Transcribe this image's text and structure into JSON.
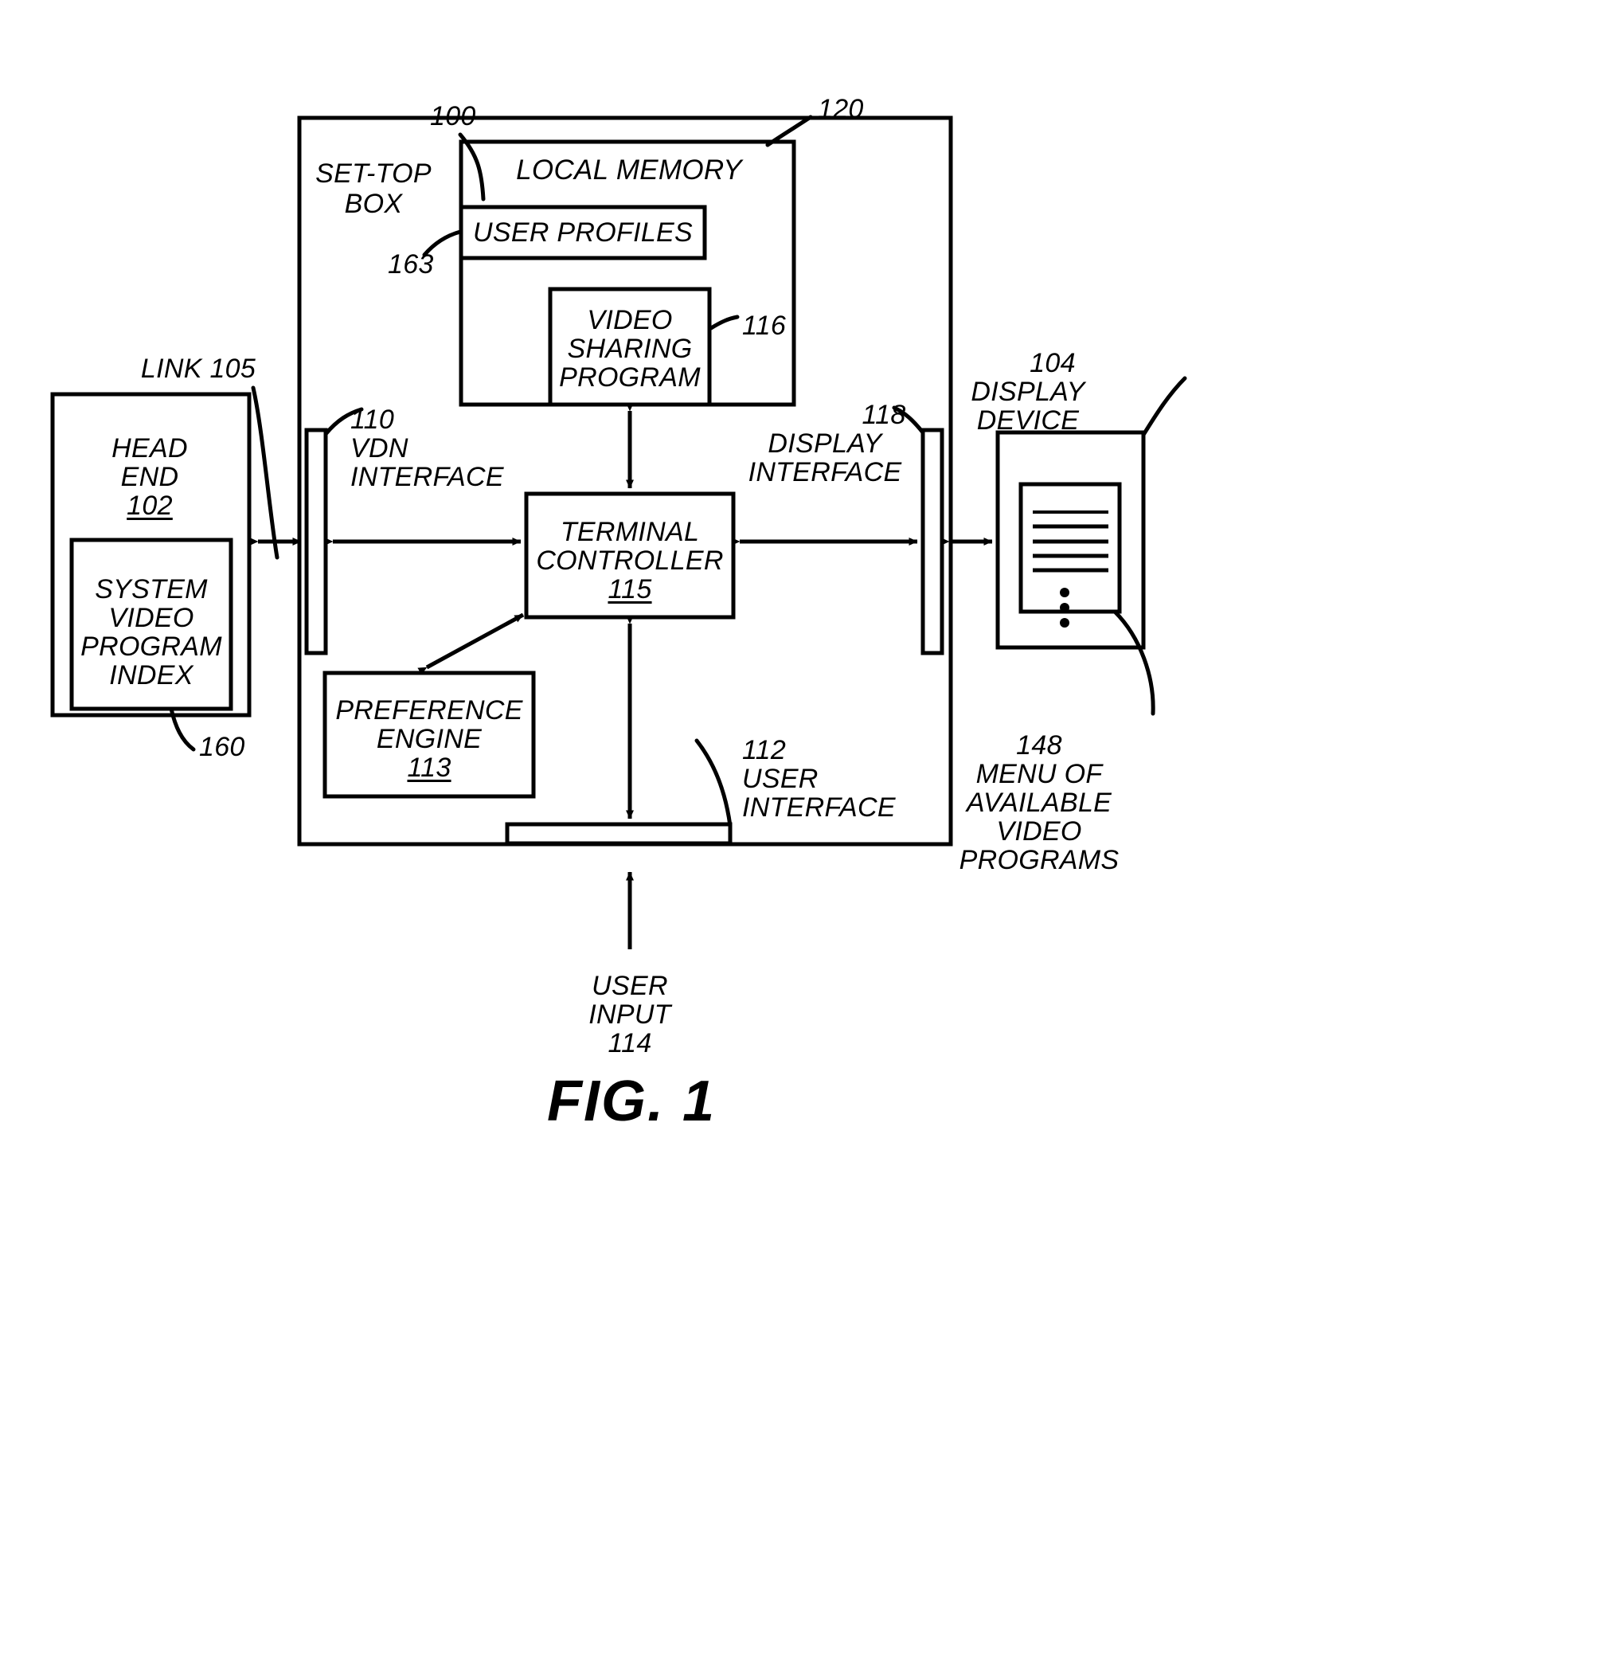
{
  "figure": {
    "caption": "FIG. 1",
    "title": "Set-top box video sharing system block diagram"
  },
  "blocks": {
    "set_top_box": {
      "label": "SET-TOP\nBOX",
      "ref": "100"
    },
    "local_memory": {
      "label": "LOCAL MEMORY",
      "ref": "120"
    },
    "user_profiles": {
      "label": "USER PROFILES",
      "ref": "163"
    },
    "video_sharing_program": {
      "label": "VIDEO\nSHARING\nPROGRAM",
      "ref": "116"
    },
    "terminal_controller": {
      "label": "TERMINAL\nCONTROLLER",
      "ref": "115"
    },
    "preference_engine": {
      "label": "PREFERENCE\nENGINE",
      "ref": "113"
    },
    "vdn_interface": {
      "ref": "110",
      "label": "VDN\nINTERFACE"
    },
    "display_interface": {
      "ref": "118",
      "label": "DISPLAY\nINTERFACE"
    },
    "user_interface": {
      "ref": "112",
      "label": "USER\nINTERFACE"
    },
    "head_end": {
      "label": "HEAD\nEND",
      "ref": "102"
    },
    "system_video_program_index": {
      "label": "SYSTEM\nVIDEO\nPROGRAM\nINDEX",
      "ref": "160"
    },
    "display_device": {
      "ref": "104",
      "label": "DISPLAY\nDEVICE"
    },
    "menu_of_available_video_programs": {
      "ref": "148",
      "label": "MENU OF\nAVAILABLE\nVIDEO\nPROGRAMS"
    },
    "link": {
      "label": "LINK 105"
    },
    "user_input": {
      "label": "USER\nINPUT\n114"
    }
  },
  "labels": {
    "ref_100": "100",
    "ref_120": "120",
    "ref_163": "163",
    "ref_116": "116",
    "ref_110": "110",
    "ref_118": "118",
    "ref_112": "112",
    "ref_104": "104",
    "ref_148": "148",
    "ref_160": "160",
    "ref_102": "102",
    "ref_113": "113",
    "ref_115": "115",
    "link_105": "LINK 105",
    "set_top_box_l1": "SET-TOP",
    "set_top_box_l2": "BOX",
    "local_memory": "LOCAL MEMORY",
    "user_profiles": "USER PROFILES",
    "vsp_l1": "VIDEO",
    "vsp_l2": "SHARING",
    "vsp_l3": "PROGRAM",
    "tc_l1": "TERMINAL",
    "tc_l2": "CONTROLLER",
    "pe_l1": "PREFERENCE",
    "pe_l2": "ENGINE",
    "vdn_l1": "VDN",
    "vdn_l2": "INTERFACE",
    "di_l1": "DISPLAY",
    "di_l2": "INTERFACE",
    "ui_l1": "USER",
    "ui_l2": "INTERFACE",
    "he_l1": "HEAD",
    "he_l2": "END",
    "svpi_l1": "SYSTEM",
    "svpi_l2": "VIDEO",
    "svpi_l3": "PROGRAM",
    "svpi_l4": "INDEX",
    "dd_l1": "DISPLAY",
    "dd_l2": "DEVICE",
    "menu_l1": "MENU OF",
    "menu_l2": "AVAILABLE",
    "menu_l3": "VIDEO",
    "menu_l4": "PROGRAMS",
    "ui_in_l1": "USER",
    "ui_in_l2": "INPUT",
    "ui_in_l3": "114",
    "fig_caption": "FIG. 1"
  },
  "colors": {
    "ink": "#000000",
    "paper": "#ffffff"
  }
}
